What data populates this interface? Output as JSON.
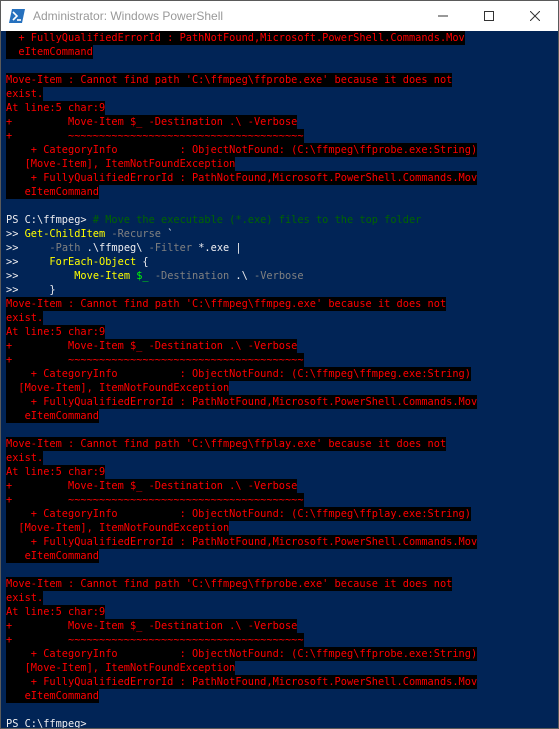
{
  "window": {
    "title": "Administrator: Windows PowerShell",
    "icon": "powershell-icon",
    "controls": [
      "minimize-icon",
      "maximize-icon",
      "close-icon"
    ]
  },
  "colors": {
    "console_bg": "#012456",
    "error_fg": "#ff0000",
    "error_bg": "#000000",
    "prompt_fg": "#eeedf0",
    "comment_fg": "#006400",
    "command_fg": "#ffff00",
    "parameter_fg": "#808080",
    "variable_fg": "#00ff00"
  },
  "console": {
    "top_partial": [
      "  + FullyQualifiedErrorId : PathNotFound,Microsoft.PowerShell.Commands.Mov",
      "  eItemCommand"
    ],
    "error_block_1": [
      "Move-Item : Cannot find path 'C:\\ffmpeg\\ffprobe.exe' because it does not",
      "exist.",
      "At line:5 char:9",
      "+         Move-Item $_ -Destination .\\ -Verbose",
      "+         ~~~~~~~~~~~~~~~~~~~~~~~~~~~~~~~~~~~~~~",
      "    + CategoryInfo          : ObjectNotFound: (C:\\ffmpeg\\ffprobe.exe:String)",
      "   [Move-Item], ItemNotFoundException",
      "    + FullyQualifiedErrorId : PathNotFound,Microsoft.PowerShell.Commands.Mov",
      "   eItemCommand"
    ],
    "command": {
      "prompt": "PS C:\\ffmpeg> ",
      "comment": "# Move the executable (*.exe) files to the top folder",
      "cont": ">> ",
      "l2_cmd": "Get-ChildItem",
      "l2_param": " -Recurse",
      "l2_tick": " `",
      "l3_indent": "    ",
      "l3_param1": "-Path",
      "l3_str1": " .\\ffmpeg\\",
      "l3_param2": " -Filter",
      "l3_str2": " *.exe",
      "l3_pipe": " |",
      "l4_indent": "    ",
      "l4_cmd": "ForEach-Object",
      "l4_brace": " {",
      "l5_indent": "        ",
      "l5_cmd": "Move-Item",
      "l5_var": " $_",
      "l5_param1": " -Destination",
      "l5_str": " .\\",
      "l5_param2": " -Verbose",
      "l6_indent": "    ",
      "l6_brace": "}"
    },
    "error_block_2": [
      "Move-Item : Cannot find path 'C:\\ffmpeg\\ffmpeg.exe' because it does not",
      "exist.",
      "At line:5 char:9",
      "+         Move-Item $_ -Destination .\\ -Verbose",
      "+         ~~~~~~~~~~~~~~~~~~~~~~~~~~~~~~~~~~~~~~",
      "    + CategoryInfo          : ObjectNotFound: (C:\\ffmpeg\\ffmpeg.exe:String)",
      "  [Move-Item], ItemNotFoundException",
      "    + FullyQualifiedErrorId : PathNotFound,Microsoft.PowerShell.Commands.Mov",
      "   eItemCommand"
    ],
    "error_block_3": [
      "Move-Item : Cannot find path 'C:\\ffmpeg\\ffplay.exe' because it does not",
      "exist.",
      "At line:5 char:9",
      "+         Move-Item $_ -Destination .\\ -Verbose",
      "+         ~~~~~~~~~~~~~~~~~~~~~~~~~~~~~~~~~~~~~~",
      "    + CategoryInfo          : ObjectNotFound: (C:\\ffmpeg\\ffplay.exe:String)",
      "  [Move-Item], ItemNotFoundException",
      "    + FullyQualifiedErrorId : PathNotFound,Microsoft.PowerShell.Commands.Mov",
      "   eItemCommand"
    ],
    "error_block_4": [
      "Move-Item : Cannot find path 'C:\\ffmpeg\\ffprobe.exe' because it does not",
      "exist.",
      "At line:5 char:9",
      "+         Move-Item $_ -Destination .\\ -Verbose",
      "+         ~~~~~~~~~~~~~~~~~~~~~~~~~~~~~~~~~~~~~~",
      "    + CategoryInfo          : ObjectNotFound: (C:\\ffmpeg\\ffprobe.exe:String)",
      "   [Move-Item], ItemNotFoundException",
      "    + FullyQualifiedErrorId : PathNotFound,Microsoft.PowerShell.Commands.Mov",
      "   eItemCommand"
    ],
    "final_prompt": "PS C:\\ffmpeg> "
  }
}
